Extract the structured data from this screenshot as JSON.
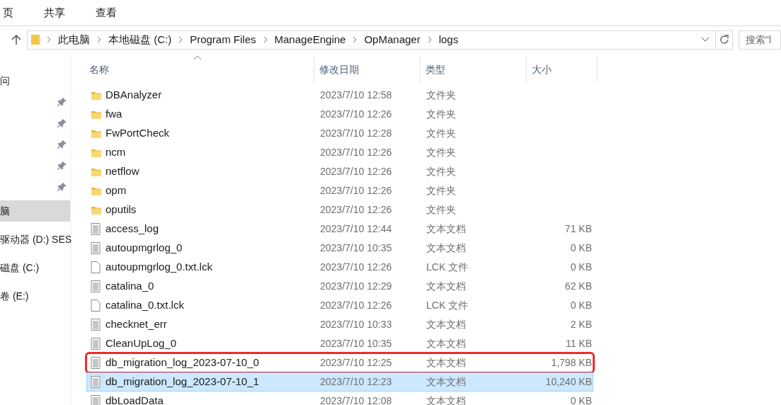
{
  "ribbon_tabs": [
    {
      "label": "页",
      "selected": false
    },
    {
      "label": "共享",
      "selected": false
    },
    {
      "label": "查看",
      "selected": false
    }
  ],
  "address_bar": {
    "path": [
      "此电脑",
      "本地磁盘 (C:)",
      "Program Files",
      "ManageEngine",
      "OpManager",
      "logs"
    ]
  },
  "search": {
    "placeholder": "搜索\"l"
  },
  "sidebar": {
    "items": [
      {
        "label": "问",
        "selected": false
      },
      {
        "pinned": true,
        "selected": false
      },
      {
        "pinned": true,
        "selected": false
      },
      {
        "pinned": true,
        "selected": false
      },
      {
        "pinned": true,
        "selected": false
      },
      {
        "pinned": true,
        "selected": false
      },
      {
        "label": "脑",
        "selected": true
      },
      {
        "label": "驱动器 (D:) SES",
        "selected": false
      },
      {
        "label": "磁盘 (C:)",
        "selected": false
      },
      {
        "label": "卷 (E:)",
        "selected": false
      }
    ]
  },
  "table": {
    "columns": [
      "名称",
      "修改日期",
      "类型",
      "大小"
    ],
    "rows": [
      {
        "kind": "folder",
        "name": "DBAnalyzer",
        "date": "2023/7/10 12:58",
        "type": "文件夹",
        "selected": false,
        "annotated": false
      },
      {
        "kind": "folder",
        "name": "fwa",
        "date": "2023/7/10 12:26",
        "type": "文件夹",
        "selected": false,
        "annotated": false
      },
      {
        "kind": "folder",
        "name": "FwPortCheck",
        "date": "2023/7/10 12:28",
        "type": "文件夹",
        "selected": false,
        "annotated": false
      },
      {
        "kind": "folder",
        "name": "ncm",
        "date": "2023/7/10 12:26",
        "type": "文件夹",
        "selected": false,
        "annotated": false
      },
      {
        "kind": "folder",
        "name": "netflow",
        "date": "2023/7/10 12:26",
        "type": "文件夹",
        "selected": false,
        "annotated": false
      },
      {
        "kind": "folder",
        "name": "opm",
        "date": "2023/7/10 12:26",
        "type": "文件夹",
        "selected": false,
        "annotated": false
      },
      {
        "kind": "folder",
        "name": "oputils",
        "date": "2023/7/10 12:26",
        "type": "文件夹",
        "selected": false,
        "annotated": false
      },
      {
        "kind": "text",
        "name": "access_log",
        "date": "2023/7/10 12:44",
        "type": "文本文档",
        "size": "71 KB",
        "selected": false,
        "annotated": false
      },
      {
        "kind": "text",
        "name": "autoupmgrlog_0",
        "date": "2023/7/10 10:35",
        "type": "文本文档",
        "size": "0 KB",
        "selected": false,
        "annotated": false
      },
      {
        "kind": "blank",
        "name": "autoupmgrlog_0.txt.lck",
        "date": "2023/7/10 12:26",
        "type": "LCK 文件",
        "size": "0 KB",
        "selected": false,
        "annotated": false
      },
      {
        "kind": "text",
        "name": "catalina_0",
        "date": "2023/7/10 12:29",
        "type": "文本文档",
        "size": "62 KB",
        "selected": false,
        "annotated": false
      },
      {
        "kind": "blank",
        "name": "catalina_0.txt.lck",
        "date": "2023/7/10 12:26",
        "type": "LCK 文件",
        "size": "0 KB",
        "selected": false,
        "annotated": false
      },
      {
        "kind": "text",
        "name": "checknet_err",
        "date": "2023/7/10 10:33",
        "type": "文本文档",
        "size": "2 KB",
        "selected": false,
        "annotated": false
      },
      {
        "kind": "text",
        "name": "CleanUpLog_0",
        "date": "2023/7/10 10:35",
        "type": "文本文档",
        "size": "11 KB",
        "selected": false,
        "annotated": false
      },
      {
        "kind": "text",
        "name": "db_migration_log_2023-07-10_0",
        "date": "2023/7/10 12:25",
        "type": "文本文档",
        "size": "1,798 KB",
        "selected": false,
        "annotated": true
      },
      {
        "kind": "text",
        "name": "db_migration_log_2023-07-10_1",
        "date": "2023/7/10 12:23",
        "type": "文本文档",
        "size": "10,240 KB",
        "selected": true,
        "annotated": false
      },
      {
        "kind": "text",
        "name": "dbLoadData",
        "date": "2023/7/10 12:08",
        "type": "文本文档",
        "size": "0 KB",
        "selected": false,
        "annotated": false
      }
    ]
  }
}
